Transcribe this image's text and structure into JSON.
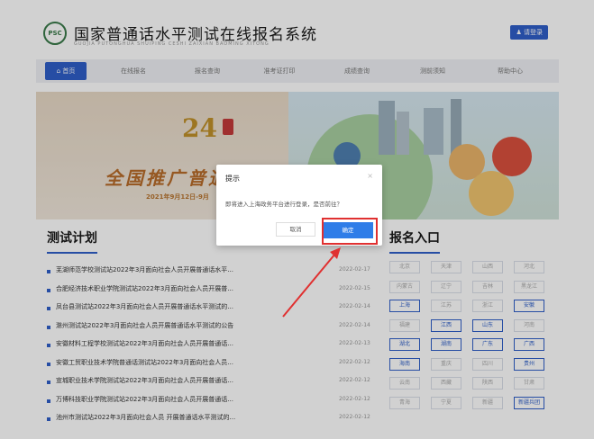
{
  "header": {
    "logo_text": "PSC",
    "title": "国家普通话水平测试在线报名系统",
    "subtitle": "GUOJIA PUTONGHUA SHUIPING CESHI ZAIXIAN BAOMING XITONG",
    "login_label": "请登录"
  },
  "nav": {
    "items": [
      "首页",
      "在线报名",
      "报名查询",
      "准考证打印",
      "成绩查询",
      "测前须知",
      "帮助中心"
    ]
  },
  "banner": {
    "number": "24",
    "slogan": "全国推广普通话",
    "date": "2021年9月12日-9月"
  },
  "plan": {
    "title": "测试计划",
    "items": [
      {
        "text": "芜湖师范学校测试站2022年3月面向社会人员开展普通话水平...",
        "date": "2022-02-17"
      },
      {
        "text": "合肥经济技术职业学院测试站2022年3月面向社会人员开展普...",
        "date": "2022-02-15"
      },
      {
        "text": "凤台县测试站2022年3月面向社会人员开展普通话水平测试的...",
        "date": "2022-02-14"
      },
      {
        "text": "滁州测试站2022年3月面向社会人员开展普通话水平测试的公告",
        "date": "2022-02-14"
      },
      {
        "text": "安徽材料工程学校测试站2022年3月面向社会人员开展普通话...",
        "date": "2022-02-13"
      },
      {
        "text": "安徽工贸职业技术学院普通话测试站2022年3月面向社会人员...",
        "date": "2022-02-12"
      },
      {
        "text": "宣城职业技术学院测试站2022年3月面向社会人员开展普通话...",
        "date": "2022-02-12"
      },
      {
        "text": "万博科技职业学院测试站2022年3月面向社会人员开展普通话...",
        "date": "2022-02-12"
      },
      {
        "text": "池州市测试站2022年3月面向社会人员 开展普通话水平测试的...",
        "date": "2022-02-12"
      }
    ]
  },
  "registration": {
    "title": "报名入口",
    "regions": [
      [
        "北京",
        "天津",
        "山西",
        "河北"
      ],
      [
        "内蒙古",
        "辽宁",
        "吉林",
        "黑龙江"
      ],
      [
        "上海",
        "江苏",
        "浙江",
        "安徽"
      ],
      [
        "福建",
        "江西",
        "山东",
        "河南"
      ],
      [
        "湖北",
        "湖南",
        "广东",
        "广西"
      ],
      [
        "海南",
        "重庆",
        "四川",
        "贵州"
      ],
      [
        "云南",
        "西藏",
        "陕西",
        "甘肃"
      ],
      [
        "青海",
        "宁夏",
        "新疆",
        "新疆兵团"
      ]
    ],
    "active": [
      "上海",
      "安徽",
      "江西",
      "山东",
      "湖北",
      "湖南",
      "广东",
      "广西",
      "海南",
      "贵州",
      "新疆兵团"
    ]
  },
  "dialog": {
    "title": "提示",
    "close": "×",
    "message": "即将进入上海政务平台进行登录，是否前往？",
    "cancel_label": "取消",
    "ok_label": "确定"
  },
  "colors": {
    "accent": "#2f5fc8",
    "ok_button": "#2f7de8",
    "highlight": "#e03030"
  }
}
